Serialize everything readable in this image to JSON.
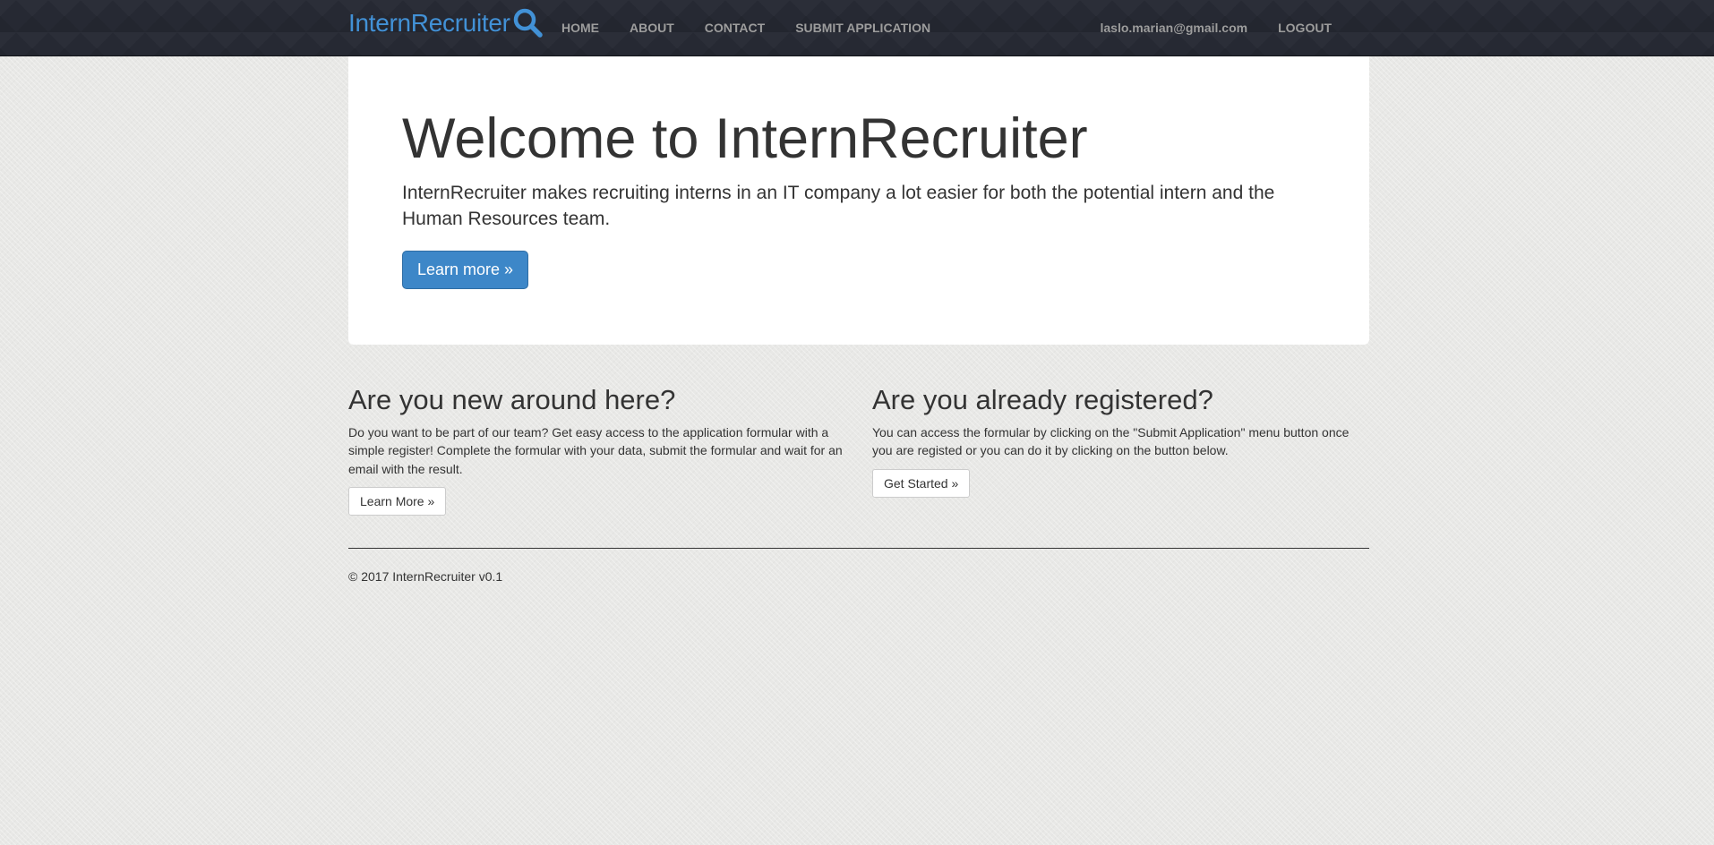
{
  "navbar": {
    "brand": "InternRecruiter",
    "brand_icon": "search-icon",
    "links": [
      "HOME",
      "ABOUT",
      "CONTACT",
      "SUBMIT APPLICATION"
    ],
    "user_email": "laslo.marian@gmail.com",
    "logout": "LOGOUT"
  },
  "jumbotron": {
    "title": "Welcome to InternRecruiter",
    "lead": "InternRecruiter makes recruiting interns in an IT company a lot easier for both the potential intern and the Human Resources team.",
    "button": "Learn more »"
  },
  "new_user": {
    "heading": "Are you new around here?",
    "text": "Do you want to be part of our team? Get easy access to the application formular with a simple register! Complete the formular with your data, submit the formular and wait for an email with the result.",
    "button": "Learn More »"
  },
  "registered_user": {
    "heading": "Are you already registered?",
    "text": "You can access the formular by clicking on the \"Submit Application\" menu button once you are registed or you can do it by clicking on the button below.",
    "button": "Get Started »"
  },
  "footer": {
    "copyright": "© 2017 InternRecruiter v0.1"
  },
  "colors": {
    "brand": "#4291d6",
    "navbar_bg": "#262933",
    "primary_button": "#3d87c8"
  }
}
